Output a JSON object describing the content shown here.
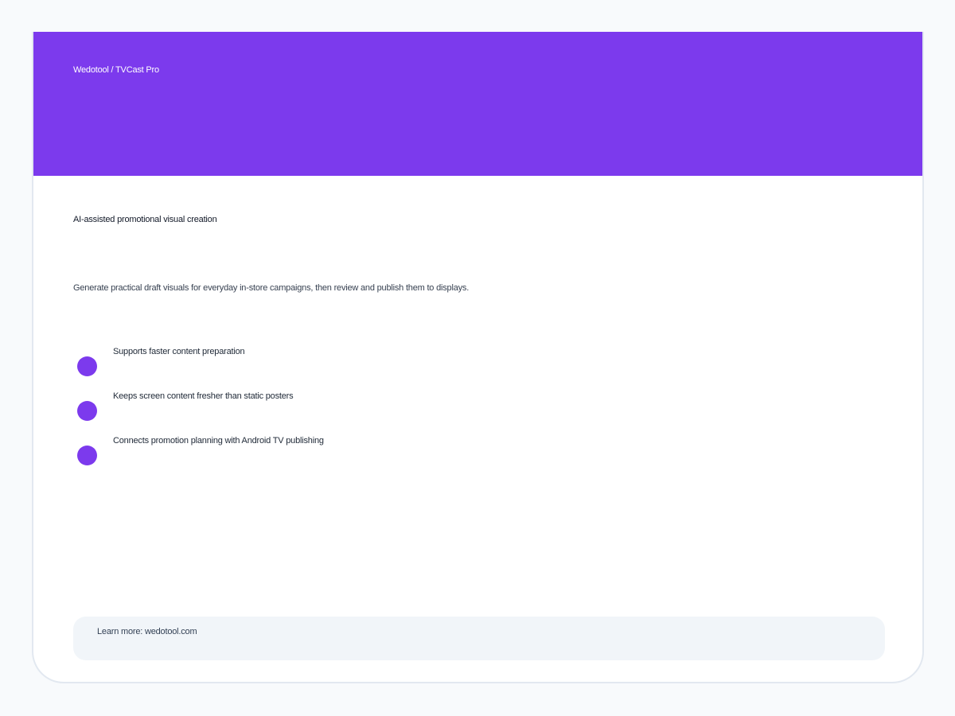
{
  "header": {
    "breadcrumb": "Wedotool / TVCast Pro",
    "background_color": "#7c3aed"
  },
  "main": {
    "title": "AI-assisted promotional visual creation",
    "subtitle": "Generate practical draft visuals for everyday in-store campaigns, then review and publish them to displays.",
    "features": [
      {
        "label": "Supports faster content preparation"
      },
      {
        "label": "Keeps screen content fresher than static posters"
      },
      {
        "label": "Connects promotion planning with Android TV publishing"
      }
    ]
  },
  "footer": {
    "link_text": "Learn more: wedotool.com"
  },
  "colors": {
    "accent": "#7c3aed",
    "footer_bg": "#f1f5f9",
    "page_bg": "#f8fafc"
  }
}
